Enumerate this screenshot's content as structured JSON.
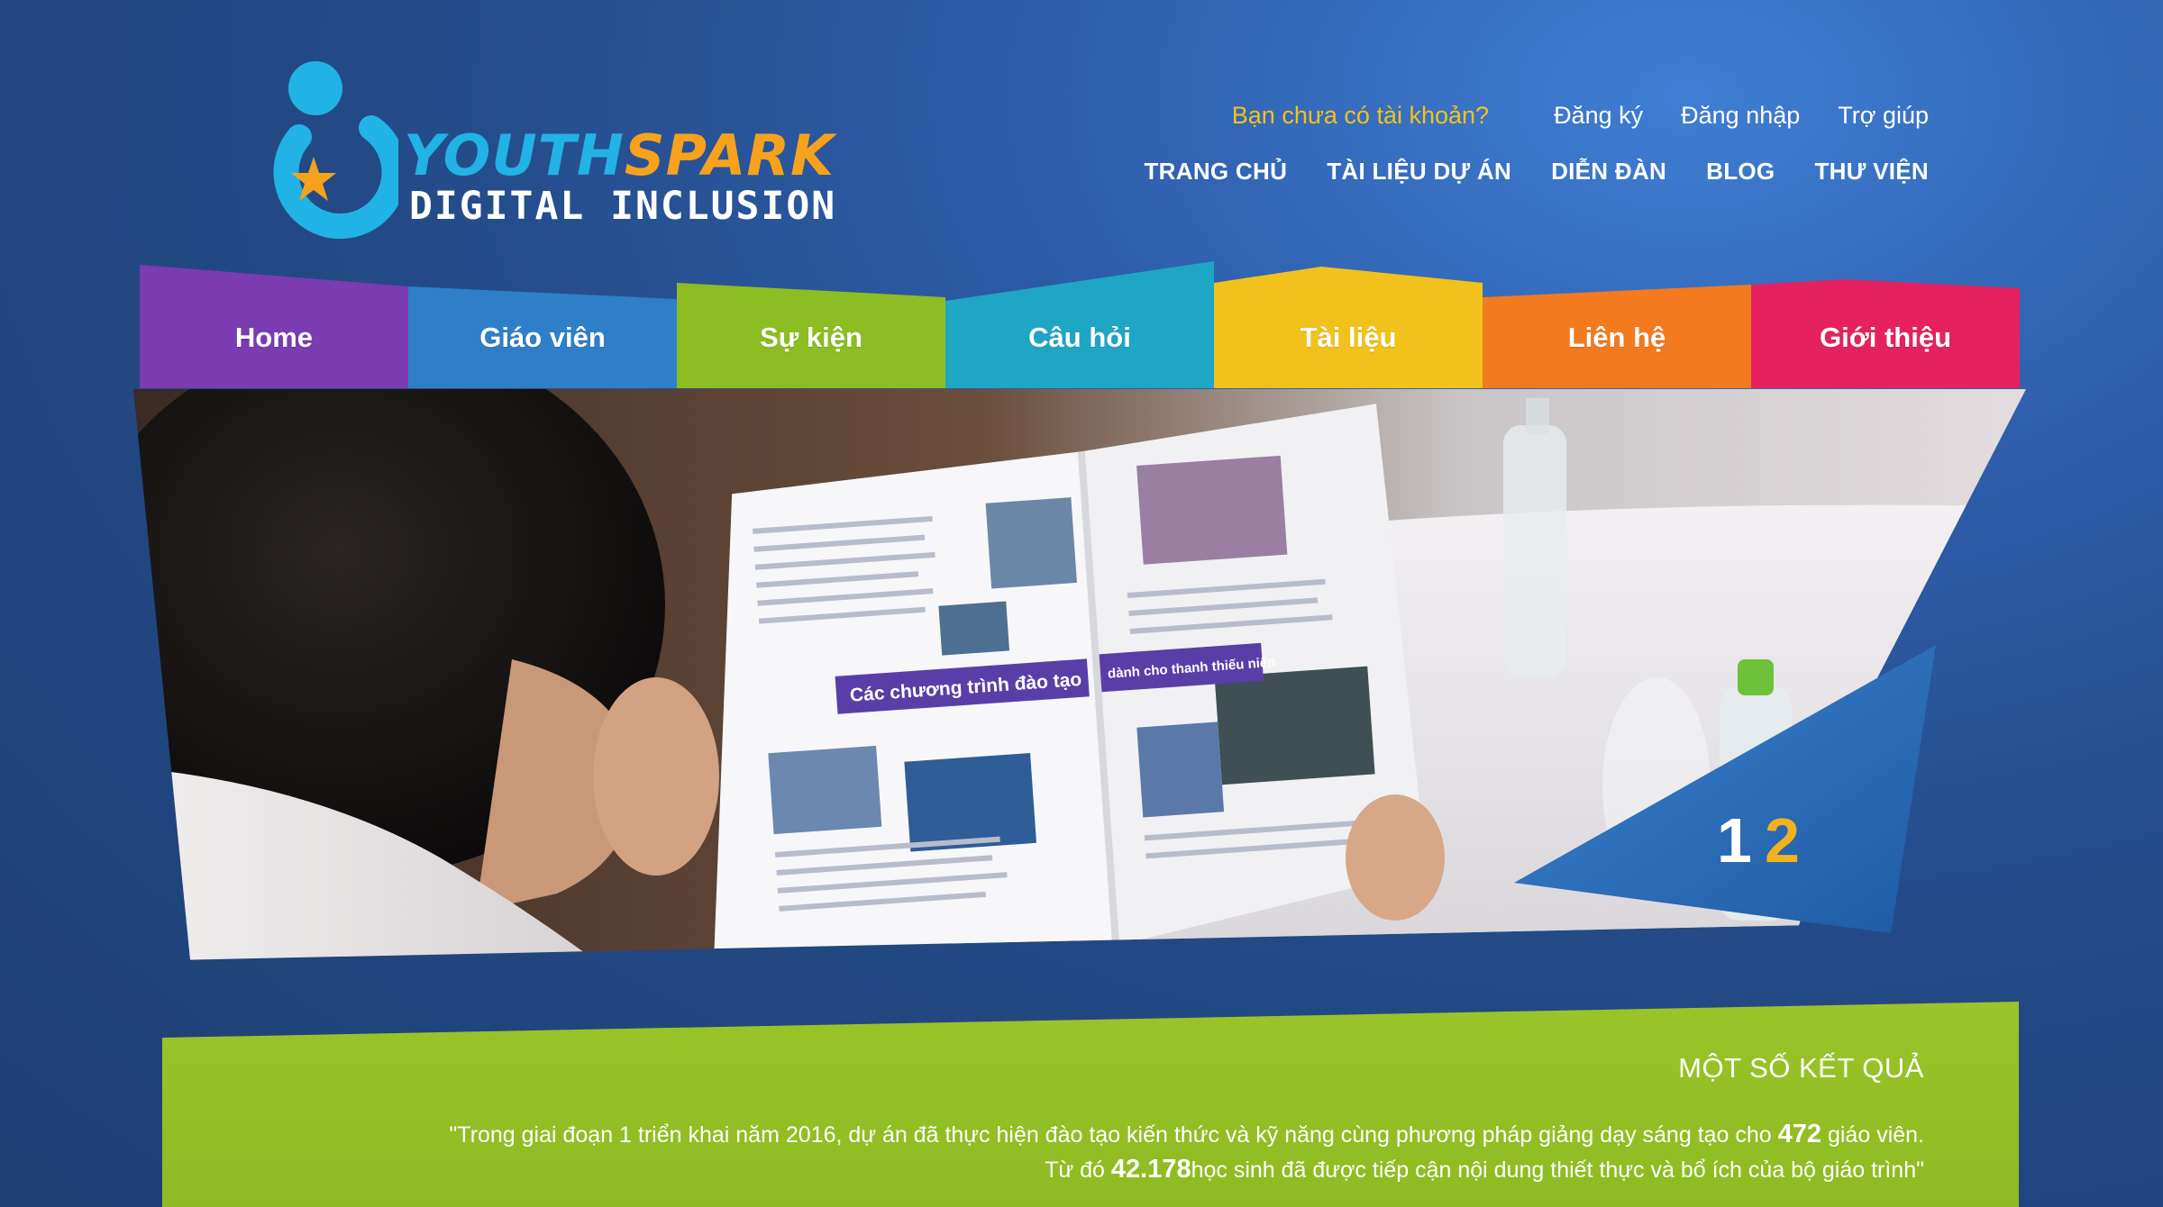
{
  "colors": {
    "background": "#2a5396",
    "logo_blue": "#22b3e6",
    "logo_orange": "#f7a21d",
    "prompt_yellow": "#f3c31a",
    "results_green": "#92c025",
    "indicator_active": "#f3b21c"
  },
  "logo": {
    "word_part1": "YOUTH",
    "word_part2": "SPARK",
    "subtitle": "DIGITAL INCLUSION"
  },
  "account": {
    "prompt": "Bạn chưa có tài khoản?",
    "register": "Đăng ký",
    "login": "Đăng nhập",
    "help": "Trợ giúp"
  },
  "top_nav": [
    "TRANG CHỦ",
    "TÀI LIỆU DỰ ÁN",
    "DIỄN ĐÀN",
    "BLOG",
    "THƯ VIỆN"
  ],
  "tabs": [
    {
      "label": "Home",
      "color": "#7a3cb0"
    },
    {
      "label": "Giáo viên",
      "color": "#2f7fc8"
    },
    {
      "label": "Sự kiện",
      "color": "#8cbd22"
    },
    {
      "label": "Câu hỏi",
      "color": "#1fa6c4"
    },
    {
      "label": "Tài liệu",
      "color": "#f2c21c"
    },
    {
      "label": "Liên hệ",
      "color": "#f37a1f"
    },
    {
      "label": "Giới thiệu",
      "color": "#e5225f"
    }
  ],
  "hero": {
    "headline_left": "Các chương trình đào tạo",
    "headline_right": "dành cho thanh thiếu niên",
    "slides": [
      "1",
      "2"
    ],
    "active_slide": 2
  },
  "results": {
    "title": "MỘT SỐ KẾT QUẢ",
    "line1_pre": "\"Trong giai đoạn 1 triển khai năm 2016, dự án đã thực hiện đào tạo kiến thức và kỹ năng cùng phương pháp giảng dạy sáng tạo cho ",
    "teachers_count": "472",
    "line1_post": " giáo viên.",
    "line2_pre": "Từ đó ",
    "students_count": "42.178",
    "line2_post": "học sinh đã được tiếp cận nội dung thiết thực và bổ ích của bộ giáo trình\""
  }
}
